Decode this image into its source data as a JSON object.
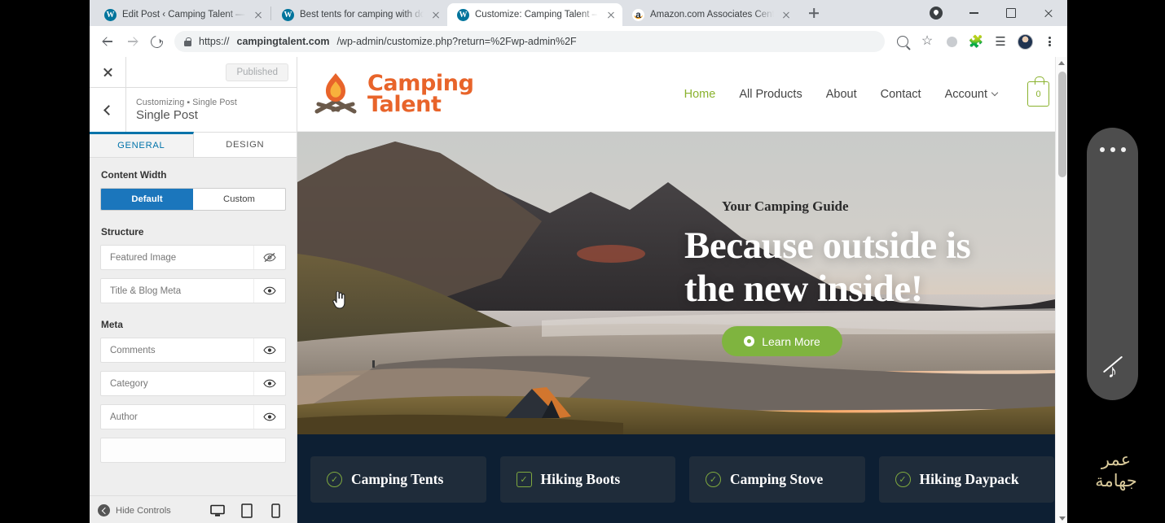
{
  "browser": {
    "tabs": [
      {
        "title": "Edit Post ‹ Camping Talent — Wo",
        "favicon": "wordpress-icon",
        "active": false
      },
      {
        "title": "Best tents for camping with dogs",
        "favicon": "wordpress-icon",
        "active": false
      },
      {
        "title": "Customize: Camping Talent – Eve",
        "favicon": "wordpress-icon",
        "active": true
      },
      {
        "title": "Amazon.com Associates Central",
        "favicon": "amazon-icon",
        "active": false
      }
    ],
    "new_tab_label": "+",
    "window_controls": {
      "minimize": "–",
      "maximize": "□",
      "close": "✕"
    },
    "toolbar": {
      "back": "back-arrow",
      "forward": "forward-arrow",
      "reload": "reload-icon",
      "url": "https://campingtalent.com/wp-admin/customize.php?return=%2Fwp-admin%2F",
      "url_bold": "campingtalent.com",
      "url_rest": "/wp-admin/customize.php?return=%2Fwp-admin%2F",
      "url_scheme": "https://",
      "icons": [
        "zoom-search-icon",
        "bookmark-star-icon",
        "circle-icon",
        "extensions-puzzle-icon",
        "media-list-icon",
        "profile-avatar",
        "kebab-menu-icon"
      ]
    }
  },
  "customizer": {
    "close_label": "✕",
    "published_label": "Published",
    "breadcrumb_prefix": "Customizing",
    "breadcrumb_sep": "▪",
    "breadcrumb_current": "Single Post",
    "panel_title": "Single Post",
    "tabs": [
      {
        "label": "GENERAL",
        "active": true
      },
      {
        "label": "DESIGN",
        "active": false
      }
    ],
    "content_width": {
      "heading": "Content Width",
      "options": [
        {
          "label": "Default",
          "selected": true
        },
        {
          "label": "Custom",
          "selected": false
        }
      ]
    },
    "structure": {
      "heading": "Structure",
      "rows": [
        {
          "label": "Featured Image",
          "visibility": "hidden"
        },
        {
          "label": "Title & Blog Meta",
          "visibility": "visible"
        }
      ]
    },
    "meta": {
      "heading": "Meta",
      "rows": [
        {
          "label": "Comments",
          "visibility": "visible"
        },
        {
          "label": "Category",
          "visibility": "visible"
        },
        {
          "label": "Author",
          "visibility": "visible"
        }
      ]
    },
    "footer": {
      "hide_controls_label": "Hide Controls",
      "devices": [
        {
          "name": "desktop-preview",
          "active": true
        },
        {
          "name": "tablet-preview",
          "active": false
        },
        {
          "name": "mobile-preview",
          "active": false
        }
      ]
    }
  },
  "site": {
    "logo": {
      "line1": "Camping",
      "line2": "Talent",
      "color": "#e8642a"
    },
    "nav": [
      {
        "label": "Home",
        "active": true
      },
      {
        "label": "All Products",
        "active": false
      },
      {
        "label": "About",
        "active": false
      },
      {
        "label": "Contact",
        "active": false
      },
      {
        "label": "Account",
        "active": false,
        "has_dropdown": true
      }
    ],
    "cart": {
      "count": "0",
      "color": "#8ab22e"
    },
    "hero": {
      "kicker": "Your Camping Guide",
      "heading_line1": "Because outside is",
      "heading_line2": "the new inside!",
      "cta_label": "Learn More",
      "cta_color": "#7fb43f"
    },
    "categories": [
      {
        "label": "Camping Tents",
        "icon": "check-circle-icon"
      },
      {
        "label": "Hiking Boots",
        "icon": "check-square-icon"
      },
      {
        "label": "Camping Stove",
        "icon": "check-circle-icon"
      },
      {
        "label": "Hiking Daypack",
        "icon": "check-circle-icon"
      }
    ],
    "categories_bg": "#0d1f33"
  },
  "overlay": {
    "menu_dots": "•••",
    "mute_icon": "muted-music-note-icon",
    "presenter_name_line1": "عمر",
    "presenter_name_line2": "جهامة",
    "name_color": "#d8c99a"
  }
}
